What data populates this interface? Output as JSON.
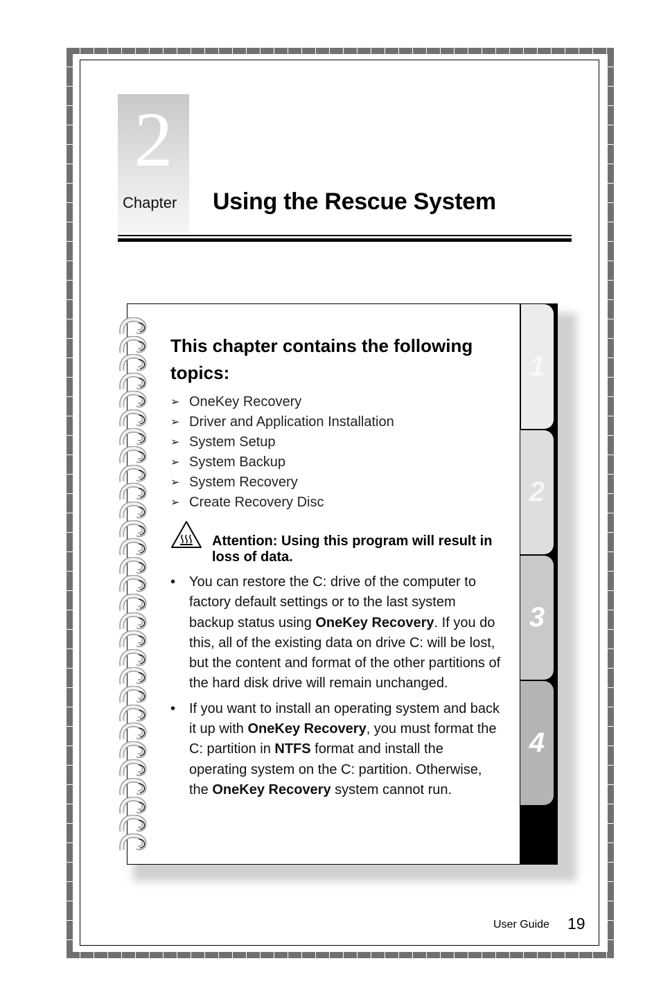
{
  "chapter": {
    "number": "2",
    "label": "Chapter",
    "title": "Using the Rescue System"
  },
  "card": {
    "heading": "This chapter contains the following topics:",
    "topics": [
      "OneKey Recovery",
      "Driver and Application Installation",
      "System Setup",
      "System Backup",
      "System Recovery",
      "Create Recovery Disc"
    ],
    "attention_icon": "hot-surface-warning-icon",
    "attention": "Attention: Using this program will result in loss of data.",
    "bullets": [
      [
        {
          "t": "You can restore the C: drive of the computer to factory default settings or to the last system backup status using "
        },
        {
          "t": "OneKey Recovery",
          "b": true
        },
        {
          "t": ". If you do this, all of the existing data on drive C: will be lost, but the content and format of the other partitions of the hard disk drive will remain unchanged."
        }
      ],
      [
        {
          "t": "If you want to install an operating system and back it up with "
        },
        {
          "t": "OneKey Recovery",
          "b": true
        },
        {
          "t": ", you must format the C: partition in "
        },
        {
          "t": "NTFS",
          "b": true
        },
        {
          "t": " format and install the operating system on the C: partition. Otherwise, the "
        },
        {
          "t": "OneKey Recovery",
          "b": true
        },
        {
          "t": " system cannot run."
        }
      ]
    ],
    "tabs": [
      "1",
      "2",
      "3",
      "4"
    ],
    "tab_colors": [
      "#ececec",
      "#dedede",
      "#c9c9c9",
      "#b4b4b4"
    ]
  },
  "footer": {
    "label": "User Guide",
    "page": "19"
  }
}
